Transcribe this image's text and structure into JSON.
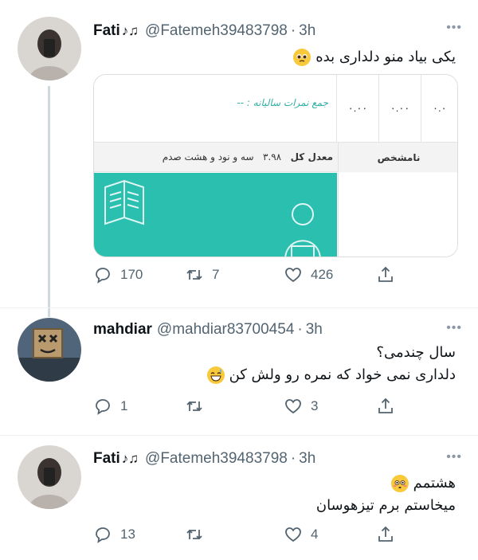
{
  "tweets": [
    {
      "name": "Fati",
      "name_suffix": "♪♫",
      "handle": "@Fatemeh39483798",
      "time": "3h",
      "text_lines": [
        "یکی بیاد منو دلداری بده"
      ],
      "emoji": "pleading-face",
      "replies": "170",
      "retweets": "7",
      "likes": "426",
      "media": {
        "sum_label": "جمع نمرات سالیانه : --",
        "cells": [
          "۰.۰۰",
          "۰.۰۰",
          "۰.۰"
        ],
        "avg_label": "معدل کل",
        "avg_value": "۳.۹۸",
        "avg_words": "سه و نود و هشت صدم",
        "unknown_label": "نامشخص"
      }
    },
    {
      "name": "mahdiar",
      "handle": "@mahdiar83700454",
      "time": "3h",
      "text_lines": [
        "سال چندمی؟",
        "دلداری نمی خواد که نمره رو ولش کن"
      ],
      "emoji": "grinning-sweat-face",
      "replies": "1",
      "retweets": "",
      "likes": "3"
    },
    {
      "name": "Fati",
      "name_suffix": "♪♫",
      "handle": "@Fatemeh39483798",
      "time": "3h",
      "text_lines": [
        "هشتمم",
        "میخاستم برم تیزهوسان"
      ],
      "emoji": "flushed-face",
      "replies": "13",
      "retweets": "",
      "likes": "4"
    }
  ],
  "ui": {
    "dot": "·",
    "more": "•••"
  },
  "colors": {
    "accent_teal": "#2bbfb0",
    "muted": "#536471",
    "line": "#cfd9de"
  }
}
